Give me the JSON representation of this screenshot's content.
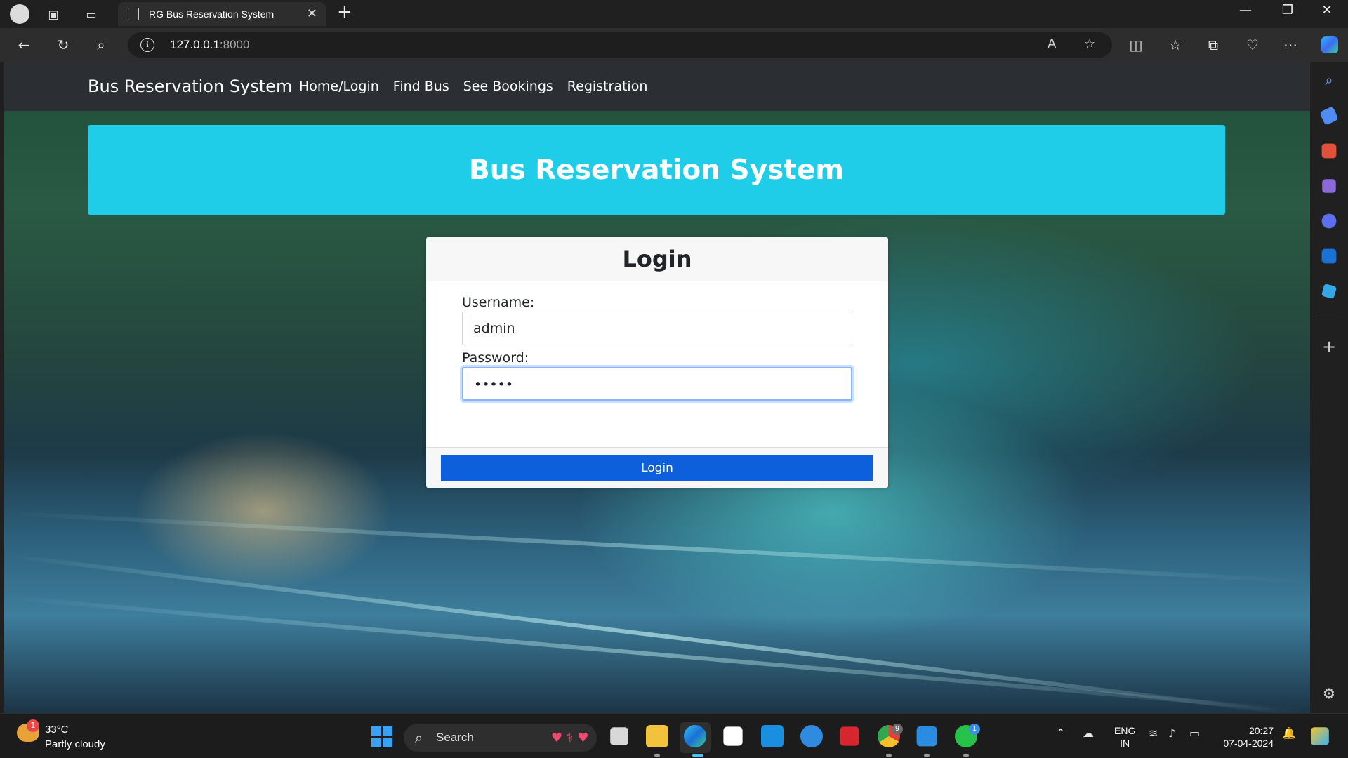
{
  "browser": {
    "tab_title": "RG Bus Reservation System",
    "url_host": "127.0.0.1",
    "url_port": ":8000"
  },
  "site": {
    "brand": "Bus Reservation System",
    "nav": [
      "Home/Login",
      "Find Bus",
      "See Bookings",
      "Registration"
    ],
    "hero_title": "Bus Reservation System"
  },
  "login": {
    "title": "Login",
    "username_label": "Username:",
    "username_value": "admin",
    "password_label": "Password:",
    "password_value": "•••••",
    "submit_label": "Login"
  },
  "colors": {
    "hero_bg": "#20cde8",
    "login_button": "#0d5fdc",
    "site_nav_bg": "#2b2f33"
  },
  "taskbar": {
    "temperature": "33°C",
    "weather": "Partly cloudy",
    "weather_badge": "1",
    "search_label": "Search",
    "chrome_badge": "9",
    "whatsapp_badge": "1",
    "lang_line1": "ENG",
    "lang_line2": "IN",
    "time": "20:27",
    "date": "07-04-2024"
  }
}
